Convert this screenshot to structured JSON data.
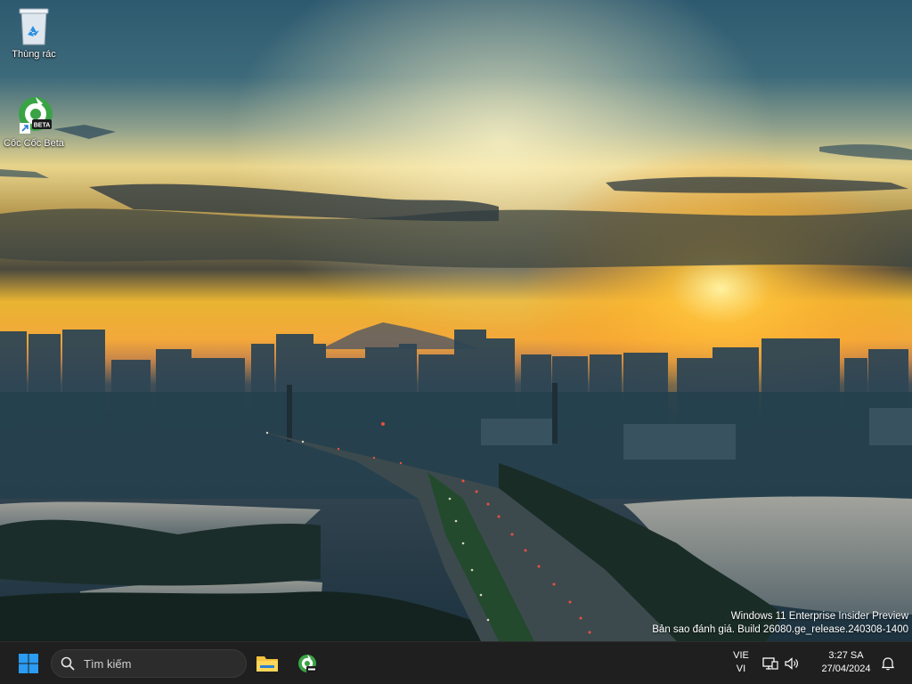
{
  "desktop": {
    "icons": [
      {
        "label": "Thùng rác",
        "icon": "recycle-bin-icon"
      },
      {
        "label": "Cốc Cốc Beta",
        "icon": "coccoc-beta-icon",
        "badge": "BETA"
      }
    ]
  },
  "watermark": {
    "line1": "Windows 11 Enterprise Insider Preview",
    "line2": "Bản sao đánh giá. Build 26080.ge_release.240308-1400"
  },
  "taskbar": {
    "search_placeholder": "Tìm kiếm",
    "pinned": [
      "start-icon",
      "file-explorer-icon",
      "coccoc-beta-icon"
    ],
    "language": {
      "primary": "VIE",
      "secondary": "VI"
    },
    "tray": [
      "network-icon",
      "volume-icon"
    ],
    "clock": {
      "time": "3:27 SA",
      "date": "27/04/2024"
    },
    "notification_icon": "bell-icon"
  },
  "colors": {
    "taskbar_bg": "#1f1f1f",
    "windows_blue": "#2b9cf2",
    "coccoc_green": "#3aa345",
    "folder_yellow": "#f7c23d"
  }
}
